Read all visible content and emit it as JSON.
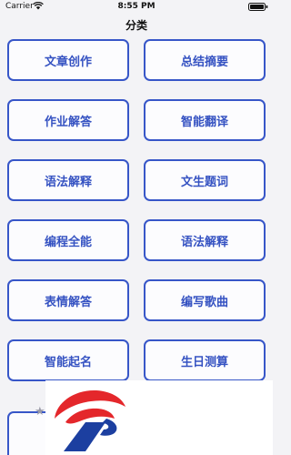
{
  "status_bar": {
    "carrier": "Carrier",
    "time": "8:55 PM",
    "icons": [
      "wifi-icon",
      "battery-icon"
    ]
  },
  "nav": {
    "title": "分类"
  },
  "categories": [
    "文章创作",
    "总结摘要",
    "作业解答",
    "智能翻译",
    "语法解释",
    "文生题词",
    "编程全能",
    "语法解释",
    "表情解答",
    "编写歌曲",
    "智能起名",
    "生日测算"
  ],
  "colors": {
    "accent": "#3552c2",
    "background": "#f3f3f6",
    "logo_red": "#e4272b",
    "logo_blue": "#1c3fa0"
  }
}
